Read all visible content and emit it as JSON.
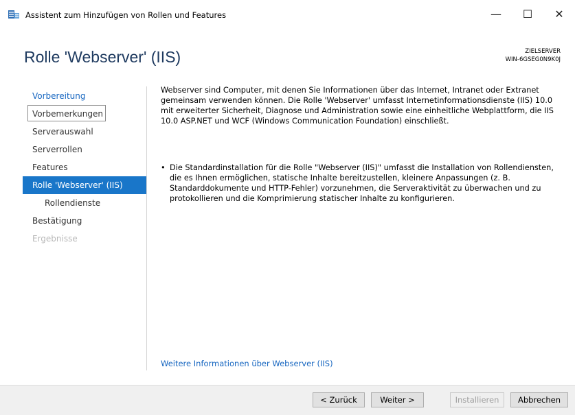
{
  "window": {
    "title": "Assistent zum Hinzufügen von Rollen und Features",
    "minimize": "—",
    "maximize": "☐",
    "close": "✕"
  },
  "header": {
    "title": "Rolle 'Webserver' (IIS)",
    "destination_label": "ZIELSERVER",
    "destination_server": "WIN-6GSEG0N9K0J"
  },
  "nav": {
    "items": [
      {
        "label": "Vorbereitung",
        "state": "link"
      },
      {
        "label": "Vorbemerkungen",
        "state": "boxed"
      },
      {
        "label": "Serverauswahl",
        "state": "normal"
      },
      {
        "label": "Serverrollen",
        "state": "normal"
      },
      {
        "label": "Features",
        "state": "normal"
      },
      {
        "label": "Rolle 'Webserver' (IIS)",
        "state": "selected"
      },
      {
        "label": "Rollendienste",
        "state": "sub"
      },
      {
        "label": "Bestätigung",
        "state": "normal"
      },
      {
        "label": "Ergebnisse",
        "state": "disabled"
      }
    ]
  },
  "content": {
    "intro": "Webserver sind Computer, mit denen Sie Informationen über das Internet, Intranet oder Extranet gemeinsam verwenden können. Die Rolle 'Webserver' umfasst Internetinformationsdienste (IIS) 10.0 mit erweiterter Sicherheit, Diagnose und Administration sowie eine einheitliche Webplattform, die IIS 10.0 ASP.NET und WCF (Windows Communication Foundation) einschließt.",
    "bullet": "Die Standardinstallation für die Rolle \"Webserver (IIS)\" umfasst die Installation von Rollendiensten, die es Ihnen ermöglichen, statische Inhalte bereitzustellen, kleinere Anpassungen (z. B. Standarddokumente und HTTP-Fehler) vorzunehmen, die Serveraktivität zu überwachen und zu protokollieren und die Komprimierung statischer Inhalte zu konfigurieren.",
    "bullet_symbol": "•",
    "more_info_link": "Weitere Informationen über Webserver (IIS)"
  },
  "footer": {
    "back_label": "< Zurück",
    "next_label": "Weiter >",
    "install_label": "Installieren",
    "cancel_label": "Abbrechen"
  },
  "colors": {
    "accent": "#1976c9",
    "link": "#1565c0",
    "title": "#1e3a5f"
  }
}
